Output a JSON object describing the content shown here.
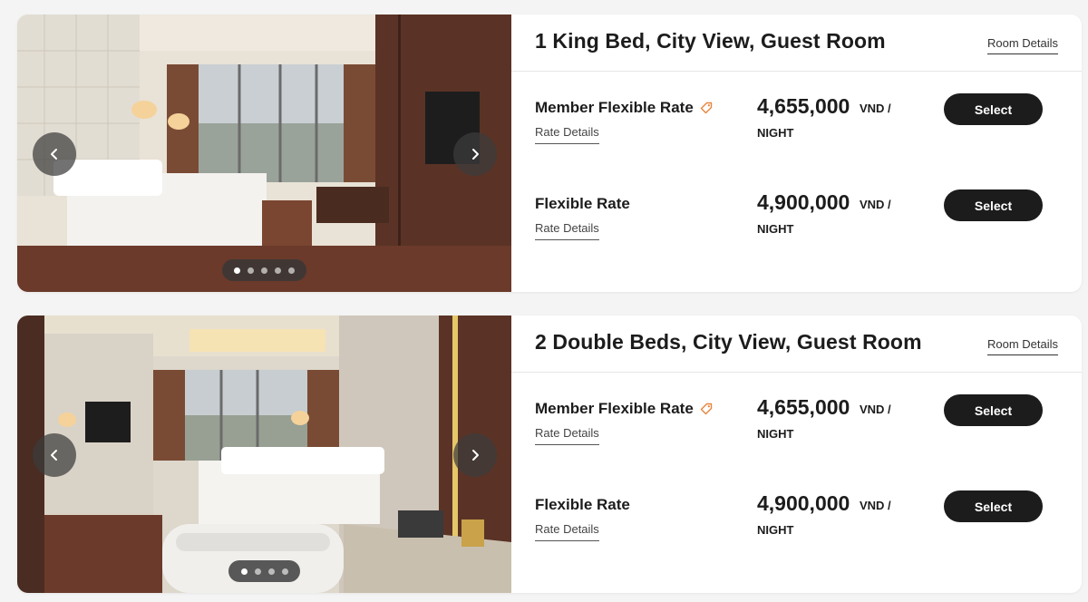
{
  "rooms": [
    {
      "title": "1 King Bed, City View, Guest Room",
      "room_details_label": "Room Details",
      "photo_icon": "room-photo",
      "carousel": {
        "dots": 5,
        "active": 0
      },
      "rates": [
        {
          "name": "Member Flexible Rate",
          "has_member_tag": true,
          "details_label": "Rate Details",
          "price": "4,655,000",
          "currency": "VND /",
          "per": "NIGHT",
          "button_label": "Select"
        },
        {
          "name": "Flexible Rate",
          "has_member_tag": false,
          "details_label": "Rate Details",
          "price": "4,900,000",
          "currency": "VND /",
          "per": "NIGHT",
          "button_label": "Select"
        }
      ]
    },
    {
      "title": "2 Double Beds, City View, Guest Room",
      "room_details_label": "Room Details",
      "photo_icon": "room-photo",
      "carousel": {
        "dots": 4,
        "active": 0
      },
      "rates": [
        {
          "name": "Member Flexible Rate",
          "has_member_tag": true,
          "details_label": "Rate Details",
          "price": "4,655,000",
          "currency": "VND /",
          "per": "NIGHT",
          "button_label": "Select"
        },
        {
          "name": "Flexible Rate",
          "has_member_tag": false,
          "details_label": "Rate Details",
          "price": "4,900,000",
          "currency": "VND /",
          "per": "NIGHT",
          "button_label": "Select"
        }
      ]
    }
  ],
  "colors": {
    "accent_tag": "#e8833a",
    "button_bg": "#1c1c1c",
    "wood": "#5a3326"
  }
}
